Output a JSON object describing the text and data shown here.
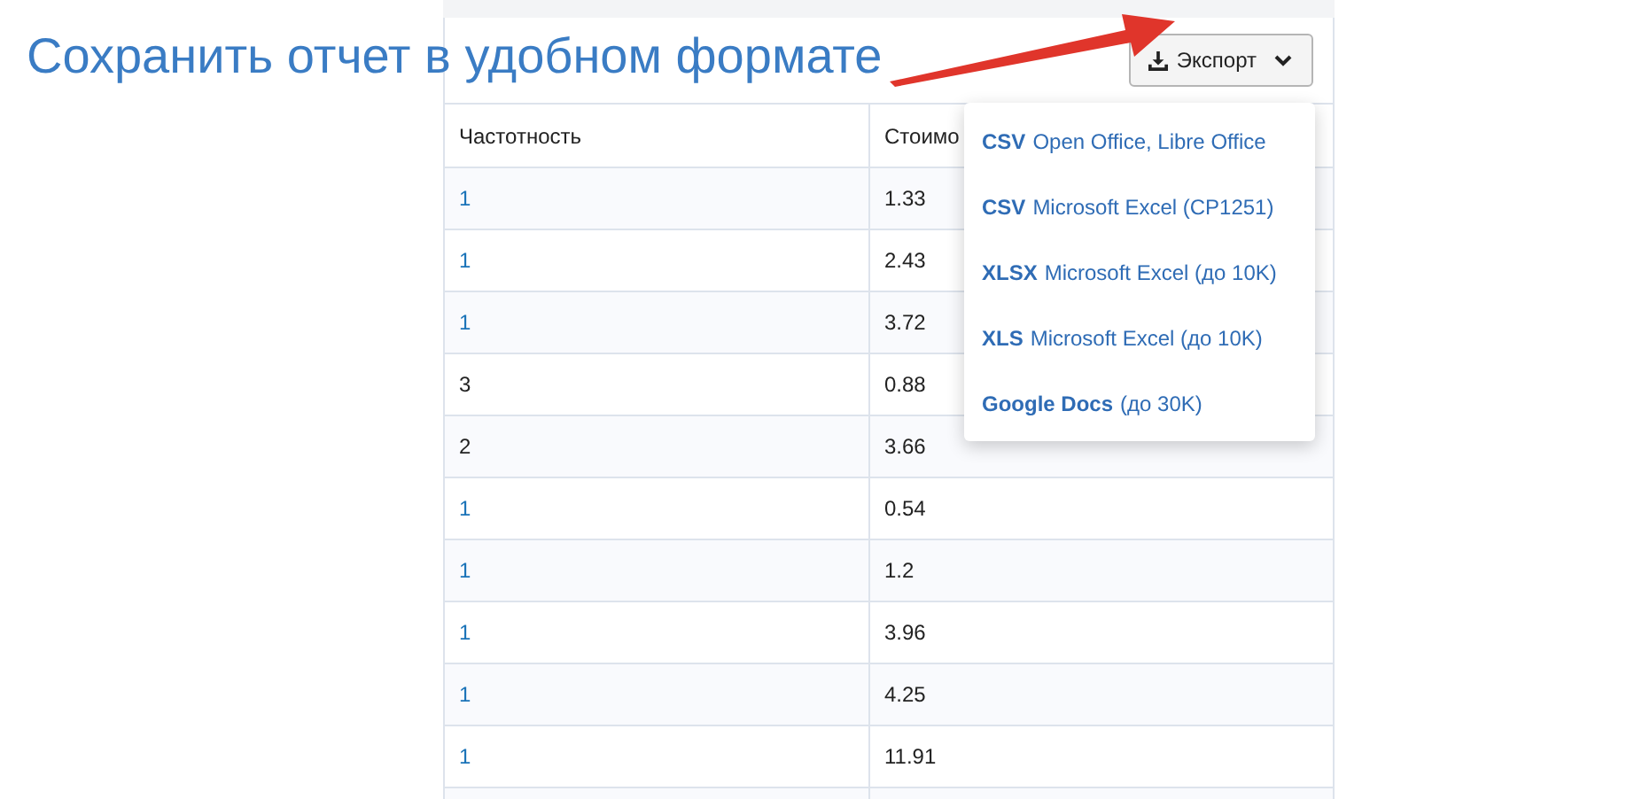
{
  "title": "Сохранить отчет в удобном формате",
  "export_button": {
    "label": "Экспорт"
  },
  "export_menu": [
    {
      "format": "CSV",
      "label": "Open Office, Libre Office"
    },
    {
      "format": "CSV",
      "label": "Microsoft Excel (CP1251)"
    },
    {
      "format": "XLSX",
      "label": "Microsoft Excel (до 10K)"
    },
    {
      "format": "XLS",
      "label": "Microsoft Excel (до 10K)"
    },
    {
      "format": "Google Docs",
      "label": "(до 30K)"
    }
  ],
  "table": {
    "columns": [
      "Частотность",
      "Стоимо"
    ],
    "rows": [
      {
        "frequency": "1",
        "link": true,
        "cost": "1.33"
      },
      {
        "frequency": "1",
        "link": true,
        "cost": "2.43"
      },
      {
        "frequency": "1",
        "link": true,
        "cost": "3.72"
      },
      {
        "frequency": "3",
        "link": false,
        "cost": "0.88"
      },
      {
        "frequency": "2",
        "link": false,
        "cost": "3.66"
      },
      {
        "frequency": "1",
        "link": true,
        "cost": "0.54"
      },
      {
        "frequency": "1",
        "link": true,
        "cost": "1.2"
      },
      {
        "frequency": "1",
        "link": true,
        "cost": "3.96"
      },
      {
        "frequency": "1",
        "link": true,
        "cost": "4.25"
      },
      {
        "frequency": "1",
        "link": true,
        "cost": "11.91"
      }
    ]
  }
}
